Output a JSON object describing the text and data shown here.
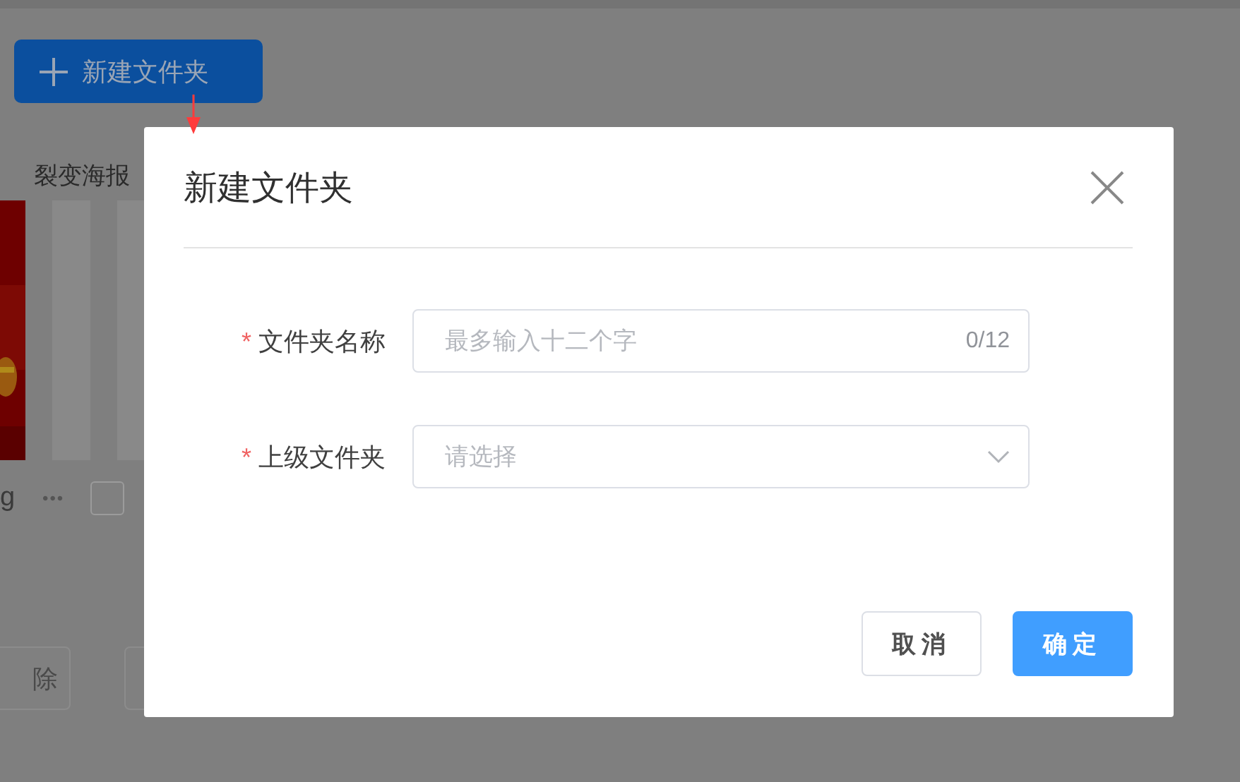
{
  "page": {
    "new_folder_button": {
      "label": "新建文件夹"
    },
    "section_title": "裂变海报",
    "file_name": "g",
    "more": "•••",
    "checkbox": {
      "checked": false
    },
    "bottom_buttons": [
      {
        "label": "除"
      }
    ]
  },
  "dialog": {
    "title": "新建文件夹",
    "fields": [
      {
        "kind": "text",
        "label": "文件夹名称",
        "required_mark": "*",
        "placeholder": "最多输入十二个字",
        "counter": "0/12"
      },
      {
        "kind": "select",
        "label": "上级文件夹",
        "required_mark": "*",
        "placeholder": "请选择"
      }
    ],
    "buttons": [
      {
        "label": "取消",
        "primary": false
      },
      {
        "label": "确定",
        "primary": true
      }
    ]
  }
}
